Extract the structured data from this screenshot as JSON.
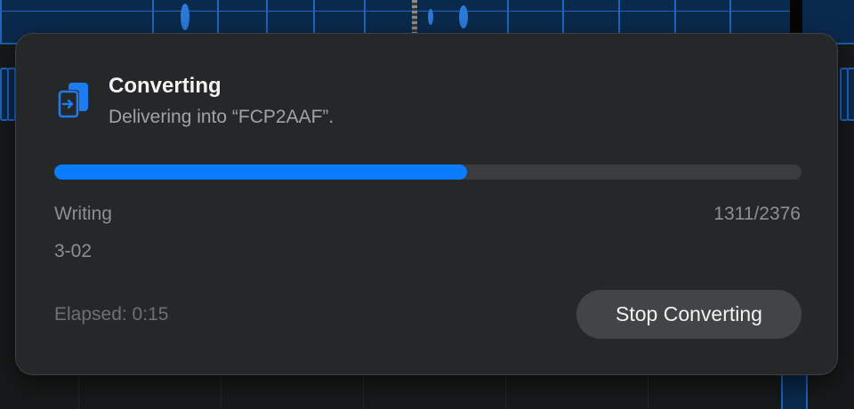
{
  "dialog": {
    "title": "Converting",
    "subtitle": "Delivering into “FCP2AAF”.",
    "icon": "document-convert-icon",
    "accent_color": "#0a7cff"
  },
  "progress": {
    "fraction": 0.552,
    "status_label": "Writing",
    "count": "1311/2376",
    "item_name": "3-02",
    "elapsed": "Elapsed: 0:15"
  },
  "actions": {
    "stop_label": "Stop Converting"
  }
}
